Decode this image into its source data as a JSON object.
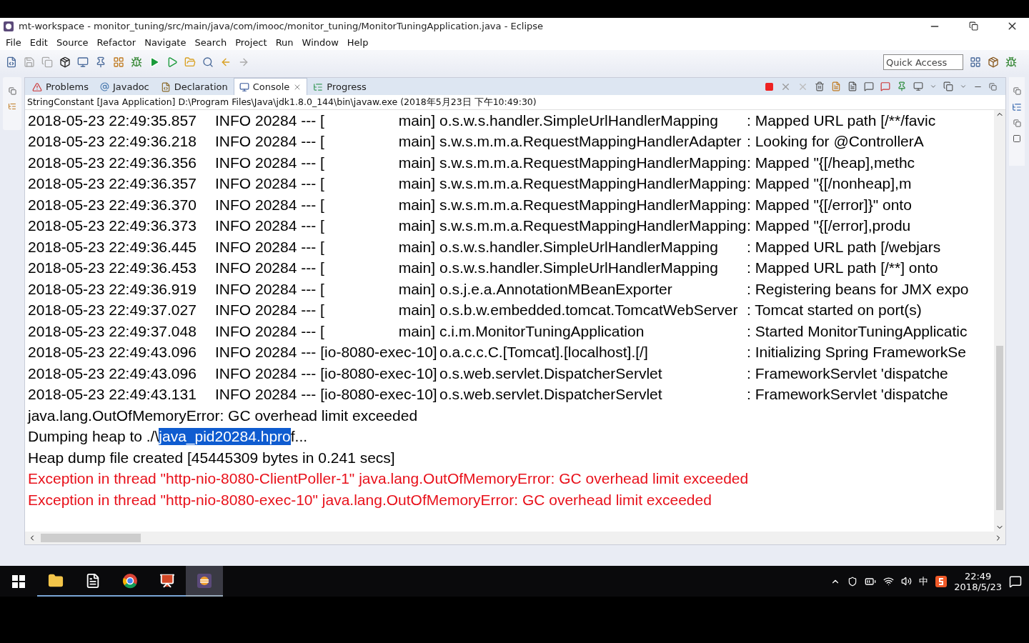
{
  "window": {
    "title": "mt-workspace - monitor_tuning/src/main/java/com/imooc/monitor_tuning/MonitorTuningApplication.java - Eclipse"
  },
  "menu": [
    "File",
    "Edit",
    "Source",
    "Refactor",
    "Navigate",
    "Search",
    "Project",
    "Run",
    "Window",
    "Help"
  ],
  "quick_access": {
    "placeholder": "Quick Access"
  },
  "tabs": [
    {
      "label": "Problems",
      "selected": false
    },
    {
      "label": "Javadoc",
      "selected": false
    },
    {
      "label": "Declaration",
      "selected": false
    },
    {
      "label": "Console",
      "selected": true
    },
    {
      "label": "Progress",
      "selected": false
    }
  ],
  "console": {
    "launch": "StringConstant [Java Application] D:\\Program Files\\Java\\jdk1.8.0_144\\bin\\javaw.exe (2018年5月23日 下午10:49:30)",
    "log_lines": [
      {
        "time": "2018-05-23 22:49:35.857",
        "head": "INFO 20284 --- [",
        "thread": "main]",
        "logger": "o.s.w.s.handler.SimpleUrlHandlerMapping",
        "message": ": Mapped URL path [/**/favic"
      },
      {
        "time": "2018-05-23 22:49:36.218",
        "head": "INFO 20284 --- [",
        "thread": "main]",
        "logger": "s.w.s.m.m.a.RequestMappingHandlerAdapter",
        "message": ": Looking for @ControllerA"
      },
      {
        "time": "2018-05-23 22:49:36.356",
        "head": "INFO 20284 --- [",
        "thread": "main]",
        "logger": "s.w.s.m.m.a.RequestMappingHandlerMapping",
        "message": ": Mapped \"{[/heap],methc"
      },
      {
        "time": "2018-05-23 22:49:36.357",
        "head": "INFO 20284 --- [",
        "thread": "main]",
        "logger": "s.w.s.m.m.a.RequestMappingHandlerMapping",
        "message": ": Mapped \"{[/nonheap],m"
      },
      {
        "time": "2018-05-23 22:49:36.370",
        "head": "INFO 20284 --- [",
        "thread": "main]",
        "logger": "s.w.s.m.m.a.RequestMappingHandlerMapping",
        "message": ": Mapped \"{[/error]}\" onto"
      },
      {
        "time": "2018-05-23 22:49:36.373",
        "head": "INFO 20284 --- [",
        "thread": "main]",
        "logger": "s.w.s.m.m.a.RequestMappingHandlerMapping",
        "message": ": Mapped \"{[/error],produ"
      },
      {
        "time": "2018-05-23 22:49:36.445",
        "head": "INFO 20284 --- [",
        "thread": "main]",
        "logger": "o.s.w.s.handler.SimpleUrlHandlerMapping",
        "message": ": Mapped URL path [/webjars"
      },
      {
        "time": "2018-05-23 22:49:36.453",
        "head": "INFO 20284 --- [",
        "thread": "main]",
        "logger": "o.s.w.s.handler.SimpleUrlHandlerMapping",
        "message": ": Mapped URL path [/**] onto"
      },
      {
        "time": "2018-05-23 22:49:36.919",
        "head": "INFO 20284 --- [",
        "thread": "main]",
        "logger": "o.s.j.e.a.AnnotationMBeanExporter",
        "message": ": Registering beans for JMX expo"
      },
      {
        "time": "2018-05-23 22:49:37.027",
        "head": "INFO 20284 --- [",
        "thread": "main]",
        "logger": "o.s.b.w.embedded.tomcat.TomcatWebServer",
        "message": ": Tomcat started on port(s)"
      },
      {
        "time": "2018-05-23 22:49:37.048",
        "head": "INFO 20284 --- [",
        "thread": "main]",
        "logger": "c.i.m.MonitorTuningApplication",
        "message": ": Started MonitorTuningApplicatic"
      },
      {
        "time": "2018-05-23 22:49:43.096",
        "head": "INFO 20284 ---",
        "thread": "[io-8080-exec-10]",
        "logger": "o.a.c.c.C.[Tomcat].[localhost].[/]",
        "message": ": Initializing Spring FrameworkSe"
      },
      {
        "time": "2018-05-23 22:49:43.096",
        "head": "INFO 20284 ---",
        "thread": "[io-8080-exec-10]",
        "logger": "o.s.web.servlet.DispatcherServlet",
        "message": ": FrameworkServlet 'dispatche"
      },
      {
        "time": "2018-05-23 22:49:43.131",
        "head": "INFO 20284 ---",
        "thread": "[io-8080-exec-10]",
        "logger": "o.s.web.servlet.DispatcherServlet",
        "message": ": FrameworkServlet 'dispatche"
      }
    ],
    "output_lines": [
      {
        "kind": "stdout",
        "text": "java.lang.OutOfMemoryError: GC overhead limit exceeded"
      },
      {
        "kind": "selection",
        "before": "Dumping heap to ./\\",
        "selected_text": "java_pid20284.hpro",
        "after": "f..."
      },
      {
        "kind": "stdout",
        "text": "Heap dump file created [45445309 bytes in 0.241 secs]"
      },
      {
        "kind": "stderr",
        "text": "Exception in thread \"http-nio-8080-ClientPoller-1\" java.lang.OutOfMemoryError: GC overhead limit exceeded"
      },
      {
        "kind": "stderr",
        "text": "Exception in thread \"http-nio-8080-exec-10\" java.lang.OutOfMemoryError: GC overhead limit exceeded"
      }
    ]
  },
  "taskbar": {
    "apps": [
      {
        "kind": "folder",
        "selected": false
      },
      {
        "kind": "notepad",
        "selected": false
      },
      {
        "kind": "chrome",
        "selected": false
      },
      {
        "kind": "powerpoint",
        "selected": false
      },
      {
        "kind": "eclipse",
        "selected": true
      }
    ],
    "ime": "中",
    "time": "22:49",
    "date": "2018/5/23"
  }
}
